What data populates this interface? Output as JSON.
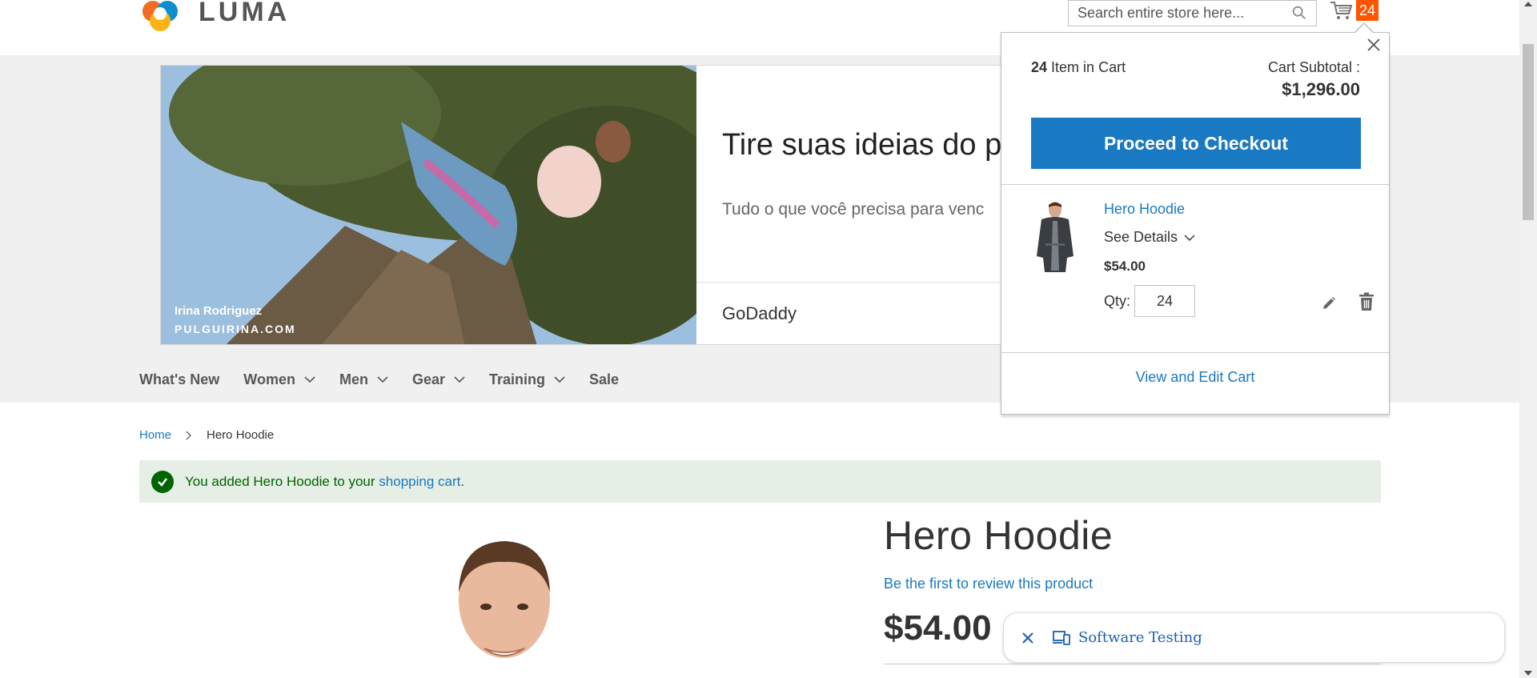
{
  "header": {
    "logo_text": "LUMA",
    "search_placeholder": "Search entire store here...",
    "cart_count": "24"
  },
  "promo": {
    "photo_caption_name": "Irina Rodriguez",
    "photo_caption_site": "PULGUIRINA.COM",
    "title": "Tire suas ideias do pa",
    "subtitle": "Tudo o que você precisa para venc",
    "brand": "GoDaddy"
  },
  "nav": {
    "items": [
      {
        "label": "What's New",
        "has_dropdown": false
      },
      {
        "label": "Women",
        "has_dropdown": true
      },
      {
        "label": "Men",
        "has_dropdown": true
      },
      {
        "label": "Gear",
        "has_dropdown": true
      },
      {
        "label": "Training",
        "has_dropdown": true
      },
      {
        "label": "Sale",
        "has_dropdown": false
      }
    ]
  },
  "breadcrumb": {
    "home": "Home",
    "current": "Hero Hoodie"
  },
  "message": {
    "prefix": "You added Hero Hoodie to your",
    "link": "shopping cart",
    "suffix": "."
  },
  "product": {
    "title": "Hero Hoodie",
    "review_link": "Be the first to review this product",
    "price": "$54.00"
  },
  "minicart": {
    "count_number": "24",
    "count_suffix": "Item in Cart",
    "subtotal_label": "Cart Subtotal :",
    "subtotal": "$1,296.00",
    "checkout_label": "Proceed to Checkout",
    "item": {
      "name": "Hero Hoodie",
      "details_label": "See Details",
      "price": "$54.00",
      "qty_label": "Qty:",
      "qty_value": "24"
    },
    "view_cart_label": "View and Edit Cart"
  },
  "floating_bar": {
    "label": "Software Testing"
  },
  "colors": {
    "link": "#1979c3",
    "primary_button": "#1979c3",
    "cart_badge": "#ff5501",
    "success_bg": "#e5efe5",
    "success_text": "#006400",
    "band_bg": "#f0f0f0"
  },
  "icons": [
    "luma-logo-icon",
    "search-icon",
    "cart-icon",
    "chevron-down-icon",
    "chevron-right-icon",
    "checkmark-icon",
    "close-icon",
    "pencil-icon",
    "trash-icon",
    "devices-icon"
  ]
}
